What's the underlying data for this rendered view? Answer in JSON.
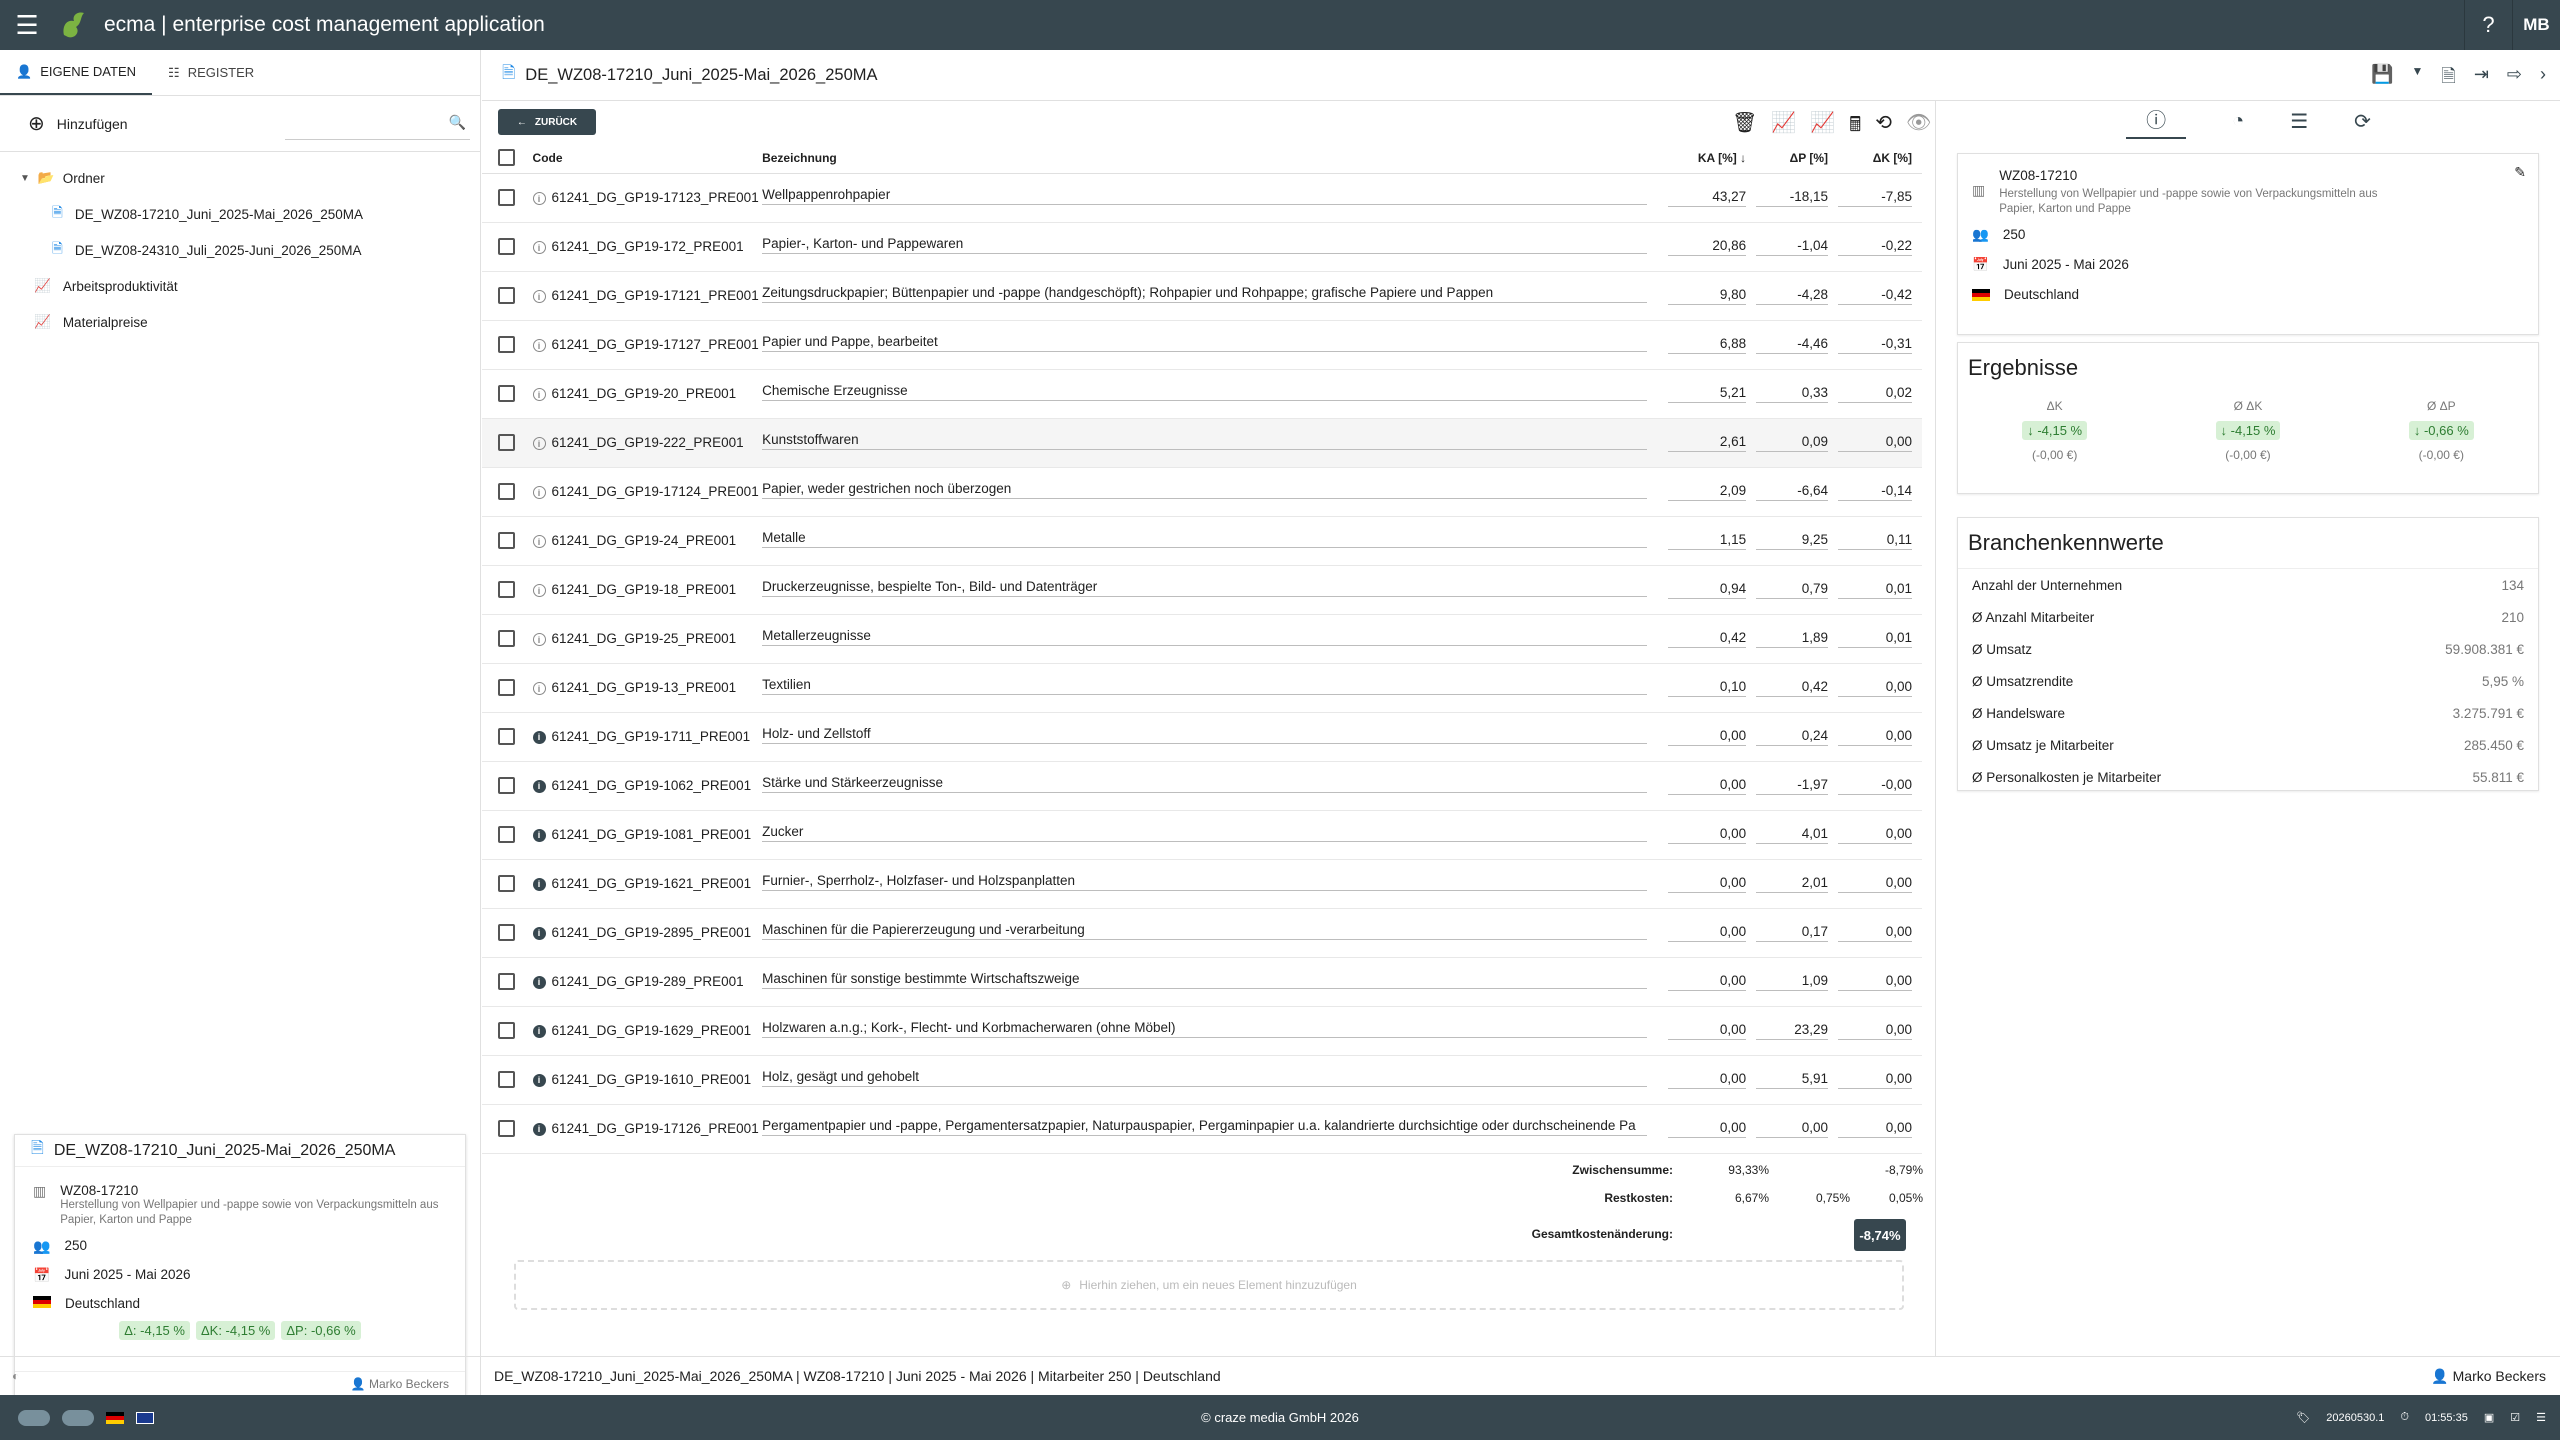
{
  "app": {
    "title": "ecma | enterprise cost management application",
    "avatar": "MB",
    "help": "?"
  },
  "left": {
    "tabs": [
      {
        "label": "EIGENE DATEN"
      },
      {
        "label": "REGISTER"
      }
    ],
    "add_label": "Hinzufügen",
    "search_placeholder": "",
    "tree": [
      {
        "label": "Ordner",
        "type": "folder"
      },
      {
        "label": "DE_WZ08-17210_Juni_2025-Mai_2026_250MA",
        "type": "doc"
      },
      {
        "label": "DE_WZ08-24310_Juli_2025-Juni_2026_250MA",
        "type": "doc"
      },
      {
        "label": "Arbeitsproduktivität",
        "type": "chart"
      },
      {
        "label": "Materialpreise",
        "type": "chart"
      }
    ],
    "card": {
      "title": "DE_WZ08-17210_Juni_2025-Mai_2026_250MA",
      "code": "WZ08-17210",
      "desc": "Herstellung von Wellpapier und -pappe sowie von Verpackungsmitteln aus Papier, Karton und Pappe",
      "employees": "250",
      "period": "Juni 2025 - Mai 2026",
      "country": "Deutschland",
      "chips": [
        "Δ: -4,15 %",
        "ΔK: -4,15 %",
        "ΔP: -0,66 %"
      ],
      "author": "Marko Beckers"
    }
  },
  "document": {
    "title": "DE_WZ08-17210_Juni_2025-Mai_2026_250MA"
  },
  "main": {
    "back_label": "ZURÜCK",
    "columns": {
      "code": "Code",
      "name": "Bezeichnung",
      "ka": "KA [%]",
      "dp": "ΔP [%]",
      "dk": "ΔK [%]"
    },
    "rows": [
      {
        "code": "61241_DG_GP19-17123_PRE001",
        "name": "Wellpappenrohpapier",
        "ka": "43,27",
        "dp": "-18,15",
        "dk": "-7,85",
        "filled": false
      },
      {
        "code": "61241_DG_GP19-172_PRE001",
        "name": "Papier-, Karton- und Pappewaren",
        "ka": "20,86",
        "dp": "-1,04",
        "dk": "-0,22",
        "filled": false
      },
      {
        "code": "61241_DG_GP19-17121_PRE001",
        "name": "Zeitungsdruckpapier; Büttenpapier und -pappe (handgeschöpft); Rohpapier und Rohpappe; grafische Papiere und Pappen",
        "ka": "9,80",
        "dp": "-4,28",
        "dk": "-0,42",
        "filled": false
      },
      {
        "code": "61241_DG_GP19-17127_PRE001",
        "name": "Papier und Pappe, bearbeitet",
        "ka": "6,88",
        "dp": "-4,46",
        "dk": "-0,31",
        "filled": false
      },
      {
        "code": "61241_DG_GP19-20_PRE001",
        "name": "Chemische Erzeugnisse",
        "ka": "5,21",
        "dp": "0,33",
        "dk": "0,02",
        "filled": false
      },
      {
        "code": "61241_DG_GP19-222_PRE001",
        "name": "Kunststoffwaren",
        "ka": "2,61",
        "dp": "0,09",
        "dk": "0,00",
        "filled": false
      },
      {
        "code": "61241_DG_GP19-17124_PRE001",
        "name": "Papier, weder gestrichen noch überzogen",
        "ka": "2,09",
        "dp": "-6,64",
        "dk": "-0,14",
        "filled": false
      },
      {
        "code": "61241_DG_GP19-24_PRE001",
        "name": "Metalle",
        "ka": "1,15",
        "dp": "9,25",
        "dk": "0,11",
        "filled": false
      },
      {
        "code": "61241_DG_GP19-18_PRE001",
        "name": "Druckerzeugnisse, bespielte Ton-, Bild- und Datenträger",
        "ka": "0,94",
        "dp": "0,79",
        "dk": "0,01",
        "filled": false
      },
      {
        "code": "61241_DG_GP19-25_PRE001",
        "name": "Metallerzeugnisse",
        "ka": "0,42",
        "dp": "1,89",
        "dk": "0,01",
        "filled": false
      },
      {
        "code": "61241_DG_GP19-13_PRE001",
        "name": "Textilien",
        "ka": "0,10",
        "dp": "0,42",
        "dk": "0,00",
        "filled": false
      },
      {
        "code": "61241_DG_GP19-1711_PRE001",
        "name": "Holz- und Zellstoff",
        "ka": "0,00",
        "dp": "0,24",
        "dk": "0,00",
        "filled": true
      },
      {
        "code": "61241_DG_GP19-1062_PRE001",
        "name": "Stärke und Stärkeerzeugnisse",
        "ka": "0,00",
        "dp": "-1,97",
        "dk": "-0,00",
        "filled": true
      },
      {
        "code": "61241_DG_GP19-1081_PRE001",
        "name": "Zucker",
        "ka": "0,00",
        "dp": "4,01",
        "dk": "0,00",
        "filled": true
      },
      {
        "code": "61241_DG_GP19-1621_PRE001",
        "name": "Furnier-, Sperrholz-, Holzfaser- und Holzspanplatten",
        "ka": "0,00",
        "dp": "2,01",
        "dk": "0,00",
        "filled": true
      },
      {
        "code": "61241_DG_GP19-2895_PRE001",
        "name": "Maschinen für die Papiererzeugung und -verarbeitung",
        "ka": "0,00",
        "dp": "0,17",
        "dk": "0,00",
        "filled": true
      },
      {
        "code": "61241_DG_GP19-289_PRE001",
        "name": "Maschinen für sonstige bestimmte Wirtschaftszweige",
        "ka": "0,00",
        "dp": "1,09",
        "dk": "0,00",
        "filled": true
      },
      {
        "code": "61241_DG_GP19-1629_PRE001",
        "name": "Holzwaren a.n.g.; Kork-, Flecht- und Korbmacherwaren (ohne Möbel)",
        "ka": "0,00",
        "dp": "23,29",
        "dk": "0,00",
        "filled": true
      },
      {
        "code": "61241_DG_GP19-1610_PRE001",
        "name": "Holz, gesägt und gehobelt",
        "ka": "0,00",
        "dp": "5,91",
        "dk": "0,00",
        "filled": true
      },
      {
        "code": "61241_DG_GP19-17126_PRE001",
        "name": "Pergamentpapier und -pappe, Pergamentersatzpapier, Naturpauspapier, Pergaminpapier u.a. kalandrierte durchsichtige oder durchscheinende Pa",
        "ka": "0,00",
        "dp": "0,00",
        "dk": "0,00",
        "filled": true
      }
    ],
    "summary": {
      "subtotal_label": "Zwischensumme:",
      "subtotal_ka": "93,33%",
      "subtotal_dk": "-8,79%",
      "rest_label": "Restkosten:",
      "rest_ka": "6,67%",
      "rest_dp": "0,75%",
      "rest_dk": "0,05%",
      "total_label": "Gesamtkostenänderung:",
      "total": "-8,74%"
    },
    "dropzone": "Hierhin ziehen, um ein neues Element hinzuzufügen"
  },
  "right": {
    "info": {
      "code": "WZ08-17210",
      "desc": "Herstellung von Wellpapier und -pappe sowie von Verpackungsmitteln aus Papier, Karton und Pappe",
      "employees": "250",
      "period": "Juni 2025 - Mai 2026",
      "country": "Deutschland"
    },
    "results": {
      "title": "Ergebnisse",
      "items": [
        {
          "label": "ΔK",
          "value": "-4,15 %",
          "eur": "(-0,00 €)"
        },
        {
          "label": "Ø ΔK",
          "value": "-4,15 %",
          "eur": "(-0,00 €)"
        },
        {
          "label": "Ø ΔP",
          "value": "-0,66 %",
          "eur": "(-0,00 €)"
        }
      ]
    },
    "industry": {
      "title": "Branchenkennwerte",
      "rows": [
        {
          "k": "Anzahl der Unternehmen",
          "v": "134"
        },
        {
          "k": "Ø Anzahl Mitarbeiter",
          "v": "210"
        },
        {
          "k": "Ø Umsatz",
          "v": "59.908.381 €"
        },
        {
          "k": "Ø Umsatzrendite",
          "v": "5,95 %"
        },
        {
          "k": "Ø Handelsware",
          "v": "3.275.791 €"
        },
        {
          "k": "Ø Umsatz je Mitarbeiter",
          "v": "285.450 €"
        },
        {
          "k": "Ø Personalkosten je Mitarbeiter",
          "v": "55.811 €"
        }
      ]
    }
  },
  "statusbar": {
    "text": "DE_WZ08-17210_Juni_2025-Mai_2026_250MA | WZ08-17210 | Juni 2025 - Mai 2026 | Mitarbeiter 250 | Deutschland",
    "user": "Marko Beckers"
  },
  "footer": {
    "copyright": "© craze media GmbH 2026",
    "version": "20260530.1",
    "time": "01:55:35"
  }
}
